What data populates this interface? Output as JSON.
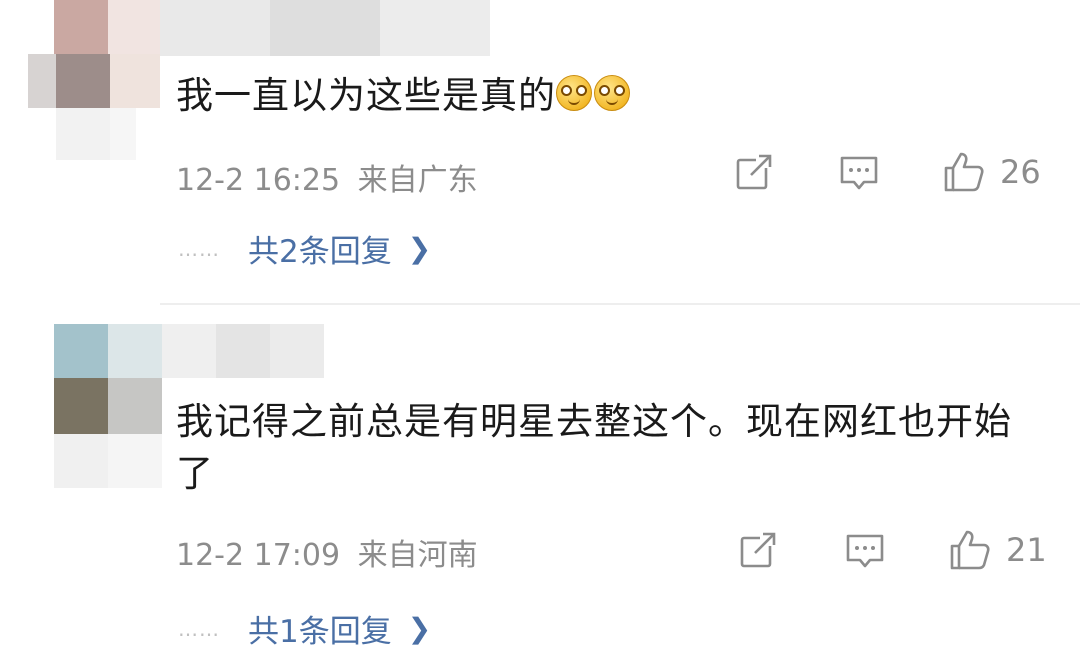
{
  "comments": [
    {
      "text": "我一直以为这些是真的",
      "emoji_count": 2,
      "emoji_name": "dizzy-eyes-emoji",
      "timestamp": "12-2 16:25",
      "location": "来自广东",
      "likes": "26",
      "replies_label": "共2条回复",
      "dots": "……"
    },
    {
      "text": "我记得之前总是有明星去整这个。现在网红也开始了",
      "timestamp": "12-2 17:09",
      "location": "来自河南",
      "likes": "21",
      "replies_label": "共1条回复",
      "dots": "……"
    }
  ],
  "icons": {
    "share": "share-icon",
    "reply": "comment-icon",
    "like": "thumbs-up-icon",
    "chevron": "chevron-right-icon"
  },
  "colors": {
    "text": "#1a1a1a",
    "meta": "#8c8c8c",
    "link": "#4a6fa5",
    "divider": "#eeeeee"
  }
}
